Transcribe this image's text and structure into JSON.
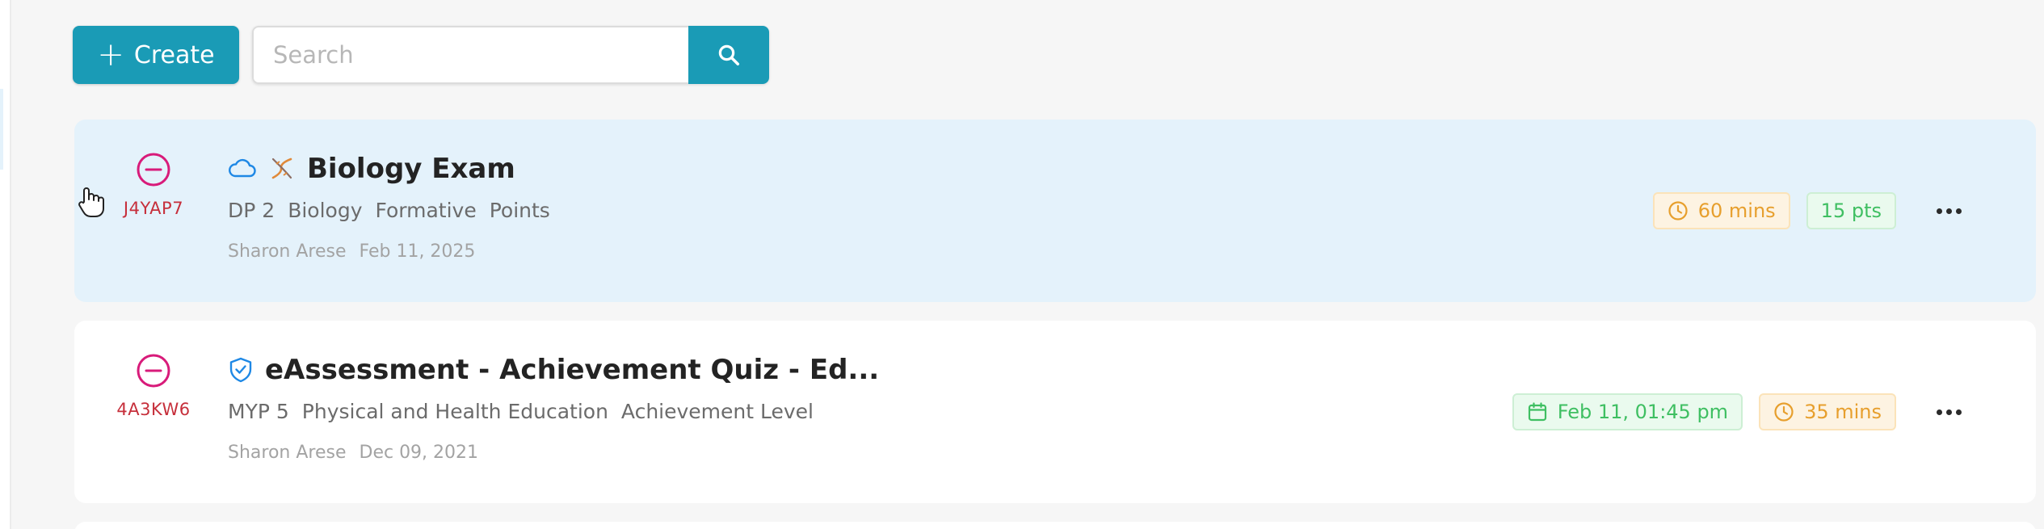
{
  "toolbar": {
    "create_label": "Create",
    "search_placeholder": "Search"
  },
  "icons": {
    "create": "plus-icon",
    "search": "search-icon",
    "status": "minus-circle-icon",
    "cloud": "cloud-icon",
    "dna": "dna-icon",
    "shield": "shield-check-icon",
    "clock": "clock-icon",
    "calendar": "calendar-icon",
    "more": "more-horizontal-icon",
    "cursor": "hand-pointer-icon"
  },
  "colors": {
    "brand": "#1a9bb6",
    "code_red": "#c62f3b",
    "status_pink": "#d81b7a",
    "active_card_bg": "#e4f2fb",
    "orange_badge": "#e79f2d",
    "green_badge": "#3fbf62"
  },
  "assessments": [
    {
      "code": "J4YAP7",
      "title": "Biology Exam",
      "tags": [
        "DP 2",
        "Biology",
        "Formative",
        "Points"
      ],
      "author": "Sharon Arese",
      "date": "Feb 11, 2025",
      "duration": "60 mins",
      "points": "15 pts"
    },
    {
      "code": "4A3KW6",
      "title": "eAssessment - Achievement Quiz - Ed...",
      "tags": [
        "MYP 5",
        "Physical and Health Education",
        "Achievement Level"
      ],
      "author": "Sharon Arese",
      "date": "Dec 09, 2021",
      "scheduled": "Feb 11, 01:45 pm",
      "duration": "35 mins"
    }
  ]
}
